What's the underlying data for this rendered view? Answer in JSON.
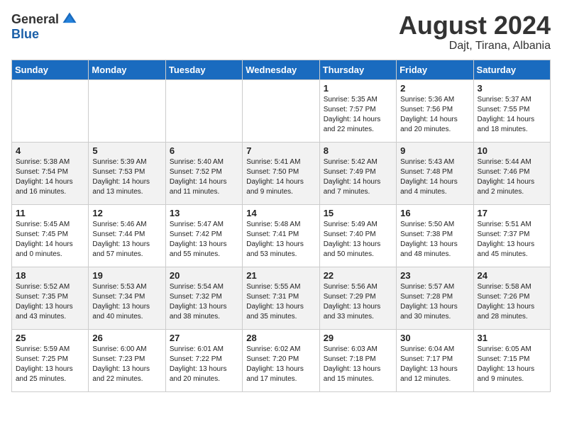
{
  "logo": {
    "general": "General",
    "blue": "Blue"
  },
  "title": {
    "month_year": "August 2024",
    "location": "Dajt, Tirana, Albania"
  },
  "headers": [
    "Sunday",
    "Monday",
    "Tuesday",
    "Wednesday",
    "Thursday",
    "Friday",
    "Saturday"
  ],
  "weeks": [
    [
      {
        "day": "",
        "info": ""
      },
      {
        "day": "",
        "info": ""
      },
      {
        "day": "",
        "info": ""
      },
      {
        "day": "",
        "info": ""
      },
      {
        "day": "1",
        "info": "Sunrise: 5:35 AM\nSunset: 7:57 PM\nDaylight: 14 hours\nand 22 minutes."
      },
      {
        "day": "2",
        "info": "Sunrise: 5:36 AM\nSunset: 7:56 PM\nDaylight: 14 hours\nand 20 minutes."
      },
      {
        "day": "3",
        "info": "Sunrise: 5:37 AM\nSunset: 7:55 PM\nDaylight: 14 hours\nand 18 minutes."
      }
    ],
    [
      {
        "day": "4",
        "info": "Sunrise: 5:38 AM\nSunset: 7:54 PM\nDaylight: 14 hours\nand 16 minutes."
      },
      {
        "day": "5",
        "info": "Sunrise: 5:39 AM\nSunset: 7:53 PM\nDaylight: 14 hours\nand 13 minutes."
      },
      {
        "day": "6",
        "info": "Sunrise: 5:40 AM\nSunset: 7:52 PM\nDaylight: 14 hours\nand 11 minutes."
      },
      {
        "day": "7",
        "info": "Sunrise: 5:41 AM\nSunset: 7:50 PM\nDaylight: 14 hours\nand 9 minutes."
      },
      {
        "day": "8",
        "info": "Sunrise: 5:42 AM\nSunset: 7:49 PM\nDaylight: 14 hours\nand 7 minutes."
      },
      {
        "day": "9",
        "info": "Sunrise: 5:43 AM\nSunset: 7:48 PM\nDaylight: 14 hours\nand 4 minutes."
      },
      {
        "day": "10",
        "info": "Sunrise: 5:44 AM\nSunset: 7:46 PM\nDaylight: 14 hours\nand 2 minutes."
      }
    ],
    [
      {
        "day": "11",
        "info": "Sunrise: 5:45 AM\nSunset: 7:45 PM\nDaylight: 14 hours\nand 0 minutes."
      },
      {
        "day": "12",
        "info": "Sunrise: 5:46 AM\nSunset: 7:44 PM\nDaylight: 13 hours\nand 57 minutes."
      },
      {
        "day": "13",
        "info": "Sunrise: 5:47 AM\nSunset: 7:42 PM\nDaylight: 13 hours\nand 55 minutes."
      },
      {
        "day": "14",
        "info": "Sunrise: 5:48 AM\nSunset: 7:41 PM\nDaylight: 13 hours\nand 53 minutes."
      },
      {
        "day": "15",
        "info": "Sunrise: 5:49 AM\nSunset: 7:40 PM\nDaylight: 13 hours\nand 50 minutes."
      },
      {
        "day": "16",
        "info": "Sunrise: 5:50 AM\nSunset: 7:38 PM\nDaylight: 13 hours\nand 48 minutes."
      },
      {
        "day": "17",
        "info": "Sunrise: 5:51 AM\nSunset: 7:37 PM\nDaylight: 13 hours\nand 45 minutes."
      }
    ],
    [
      {
        "day": "18",
        "info": "Sunrise: 5:52 AM\nSunset: 7:35 PM\nDaylight: 13 hours\nand 43 minutes."
      },
      {
        "day": "19",
        "info": "Sunrise: 5:53 AM\nSunset: 7:34 PM\nDaylight: 13 hours\nand 40 minutes."
      },
      {
        "day": "20",
        "info": "Sunrise: 5:54 AM\nSunset: 7:32 PM\nDaylight: 13 hours\nand 38 minutes."
      },
      {
        "day": "21",
        "info": "Sunrise: 5:55 AM\nSunset: 7:31 PM\nDaylight: 13 hours\nand 35 minutes."
      },
      {
        "day": "22",
        "info": "Sunrise: 5:56 AM\nSunset: 7:29 PM\nDaylight: 13 hours\nand 33 minutes."
      },
      {
        "day": "23",
        "info": "Sunrise: 5:57 AM\nSunset: 7:28 PM\nDaylight: 13 hours\nand 30 minutes."
      },
      {
        "day": "24",
        "info": "Sunrise: 5:58 AM\nSunset: 7:26 PM\nDaylight: 13 hours\nand 28 minutes."
      }
    ],
    [
      {
        "day": "25",
        "info": "Sunrise: 5:59 AM\nSunset: 7:25 PM\nDaylight: 13 hours\nand 25 minutes."
      },
      {
        "day": "26",
        "info": "Sunrise: 6:00 AM\nSunset: 7:23 PM\nDaylight: 13 hours\nand 22 minutes."
      },
      {
        "day": "27",
        "info": "Sunrise: 6:01 AM\nSunset: 7:22 PM\nDaylight: 13 hours\nand 20 minutes."
      },
      {
        "day": "28",
        "info": "Sunrise: 6:02 AM\nSunset: 7:20 PM\nDaylight: 13 hours\nand 17 minutes."
      },
      {
        "day": "29",
        "info": "Sunrise: 6:03 AM\nSunset: 7:18 PM\nDaylight: 13 hours\nand 15 minutes."
      },
      {
        "day": "30",
        "info": "Sunrise: 6:04 AM\nSunset: 7:17 PM\nDaylight: 13 hours\nand 12 minutes."
      },
      {
        "day": "31",
        "info": "Sunrise: 6:05 AM\nSunset: 7:15 PM\nDaylight: 13 hours\nand 9 minutes."
      }
    ]
  ]
}
